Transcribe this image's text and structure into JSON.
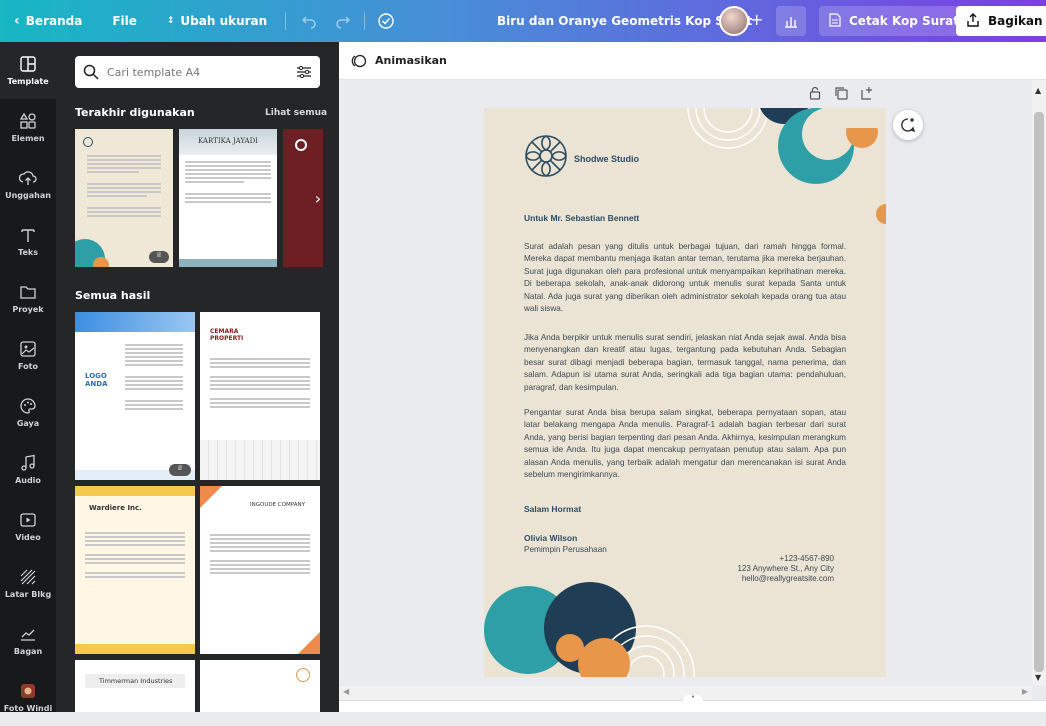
{
  "topbar": {
    "home_label": "Beranda",
    "file_label": "File",
    "resize_label": "Ubah ukuran",
    "doc_title": "Biru dan Oranye Geometris Kop Surat",
    "print_label": "Cetak Kop Surat",
    "share_label": "Bagikan"
  },
  "rail": {
    "items": [
      {
        "label": "Template",
        "icon": "template-icon"
      },
      {
        "label": "Elemen",
        "icon": "elements-icon"
      },
      {
        "label": "Unggahan",
        "icon": "upload-icon"
      },
      {
        "label": "Teks",
        "icon": "text-icon"
      },
      {
        "label": "Proyek",
        "icon": "folder-icon"
      },
      {
        "label": "Foto",
        "icon": "photo-icon"
      },
      {
        "label": "Gaya",
        "icon": "palette-icon"
      },
      {
        "label": "Audio",
        "icon": "music-icon"
      },
      {
        "label": "Video",
        "icon": "video-icon"
      },
      {
        "label": "Latar Blkg",
        "icon": "background-icon"
      },
      {
        "label": "Bagan",
        "icon": "chart-icon"
      },
      {
        "label": "Foto Windi",
        "icon": "photo-app-icon"
      }
    ]
  },
  "panel": {
    "search_placeholder": "Cari template A4",
    "recent_title": "Terakhir digunakan",
    "see_all": "Lihat semua",
    "all_results_title": "Semua hasil",
    "thumb_texts": {
      "kartika": "KARTIKA JAYADI",
      "logo_anda": "LOGO\nANDA",
      "cemara": "CEMARA\nPROPERTI",
      "wardiere": "Wardiere Inc.",
      "ingoude": "INGOUDE COMPANY",
      "timmerman": "Timmerman Industries"
    }
  },
  "toolbar2": {
    "animate_label": "Animasikan"
  },
  "letter": {
    "brand": "Shodwe Studio",
    "to": "Untuk Mr. Sebastian Bennett",
    "paragraphs": [
      "Surat adalah pesan yang ditulis untuk berbagai tujuan, dari ramah hingga formal. Mereka dapat membantu menjaga ikatan antar teman, terutama jika mereka berjauhan. Surat juga digunakan oleh para profesional untuk menyampaikan keprihatinan mereka. Di beberapa sekolah, anak-anak didorong untuk menulis surat kepada Santa untuk Natal. Ada juga surat yang diberikan oleh administrator sekolah kepada orang tua atau wali siswa.",
      "Jika Anda berpikir untuk menulis surat sendiri, jelaskan niat Anda sejak awal. Anda bisa menyenangkan dan kreatif atau lugas, tergantung pada kebutuhan Anda. Sebagian besar surat dibagi menjadi beberapa bagian, termasuk tanggal, nama penerima, dan salam. Adapun isi utama surat Anda, seringkali ada tiga bagian utama: pendahuluan, paragraf, dan kesimpulan.",
      "Pengantar surat Anda bisa berupa salam singkat, beberapa pernyataan sopan, atau latar belakang mengapa Anda menulis. Paragraf-1 adalah bagian terbesar dari surat Anda, yang berisi bagian terpenting dari pesan Anda. Akhirnya, kesimpulan merangkum semua ide Anda. Itu juga dapat mencakup pernyataan penutup atau salam. Apa pun alasan Anda menulis, yang terbaik adalah mengatur dan merencanakan isi surat Anda sebelum mengirimkannya."
    ],
    "closing": "Salam Hormat",
    "signer_name": "Olivia Wilson",
    "signer_title": "Pemimpin Perusahaan",
    "phone": "+123-4567-890",
    "address": "123 Anywhere St., Any City",
    "email": "hello@reallygreatsite.com"
  },
  "colors": {
    "teal": "#2e9fa6",
    "orange": "#e8964a",
    "navy": "#1f3d55",
    "paper": "#ebe3d3"
  }
}
